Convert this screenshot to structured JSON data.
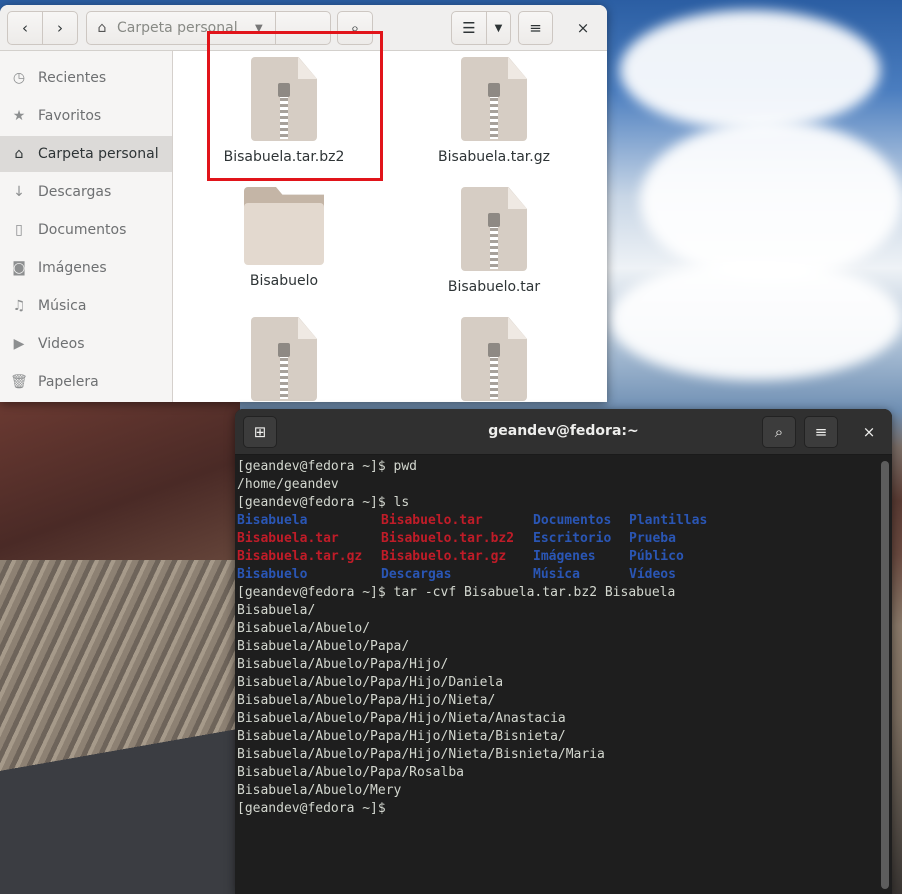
{
  "file_manager": {
    "path": "Carpeta personal",
    "sidebar": [
      {
        "label": "Recientes",
        "icon": "clock-icon",
        "glyph": "◷"
      },
      {
        "label": "Favoritos",
        "icon": "star-icon",
        "glyph": "★"
      },
      {
        "label": "Carpeta personal",
        "icon": "home-icon",
        "glyph": "⌂"
      },
      {
        "label": "Descargas",
        "icon": "download-icon",
        "glyph": "↓"
      },
      {
        "label": "Documentos",
        "icon": "document-icon",
        "glyph": "▯"
      },
      {
        "label": "Imágenes",
        "icon": "camera-icon",
        "glyph": "◙"
      },
      {
        "label": "Música",
        "icon": "music-icon",
        "glyph": "♫"
      },
      {
        "label": "Videos",
        "icon": "video-icon",
        "glyph": "▶"
      },
      {
        "label": "Papelera",
        "icon": "trash-icon",
        "glyph": "🗑"
      }
    ],
    "files": [
      {
        "name": "Bisabuela.tar.bz2",
        "type": "archive"
      },
      {
        "name": "Bisabuela.tar.gz",
        "type": "archive"
      },
      {
        "name": "Bisabuelo",
        "type": "folder"
      },
      {
        "name": "Bisabuelo.tar",
        "type": "archive"
      },
      {
        "name": "",
        "type": "archive"
      },
      {
        "name": "",
        "type": "archive"
      }
    ]
  },
  "terminal": {
    "title": "geandev@fedora:~",
    "lines_before": [
      "[geandev@fedora ~]$ pwd",
      "/home/geandev",
      "[geandev@fedora ~]$ ls"
    ],
    "ls_rows": [
      [
        {
          "t": "Bisabuela",
          "c": "blue"
        },
        {
          "t": "Bisabuelo.tar",
          "c": "red"
        },
        {
          "t": "Documentos",
          "c": "blue"
        },
        {
          "t": "Plantillas",
          "c": "blue"
        }
      ],
      [
        {
          "t": "Bisabuela.tar",
          "c": "red"
        },
        {
          "t": "Bisabuelo.tar.bz2",
          "c": "red"
        },
        {
          "t": "Escritorio",
          "c": "blue"
        },
        {
          "t": "Prueba",
          "c": "blue"
        }
      ],
      [
        {
          "t": "Bisabuela.tar.gz",
          "c": "red"
        },
        {
          "t": "Bisabuelo.tar.gz",
          "c": "red"
        },
        {
          "t": "Imágenes",
          "c": "blue"
        },
        {
          "t": "Público",
          "c": "blue"
        }
      ],
      [
        {
          "t": "Bisabuelo",
          "c": "blue"
        },
        {
          "t": "Descargas",
          "c": "blue"
        },
        {
          "t": "Música",
          "c": "blue"
        },
        {
          "t": "Vídeos",
          "c": "blue"
        }
      ]
    ],
    "lines_after": [
      "[geandev@fedora ~]$ tar -cvf Bisabuela.tar.bz2 Bisabuela",
      "Bisabuela/",
      "Bisabuela/Abuelo/",
      "Bisabuela/Abuelo/Papa/",
      "Bisabuela/Abuelo/Papa/Hijo/",
      "Bisabuela/Abuelo/Papa/Hijo/Daniela",
      "Bisabuela/Abuelo/Papa/Hijo/Nieta/",
      "Bisabuela/Abuelo/Papa/Hijo/Nieta/Anastacia",
      "Bisabuela/Abuelo/Papa/Hijo/Nieta/Bisnieta/",
      "Bisabuela/Abuelo/Papa/Hijo/Nieta/Bisnieta/Maria",
      "Bisabuela/Abuelo/Papa/Rosalba",
      "Bisabuela/Abuelo/Mery",
      "[geandev@fedora ~]$ "
    ]
  },
  "colors": {
    "red": "#c01c28",
    "blue": "#2a56b5",
    "highlight": "#e1141a"
  }
}
